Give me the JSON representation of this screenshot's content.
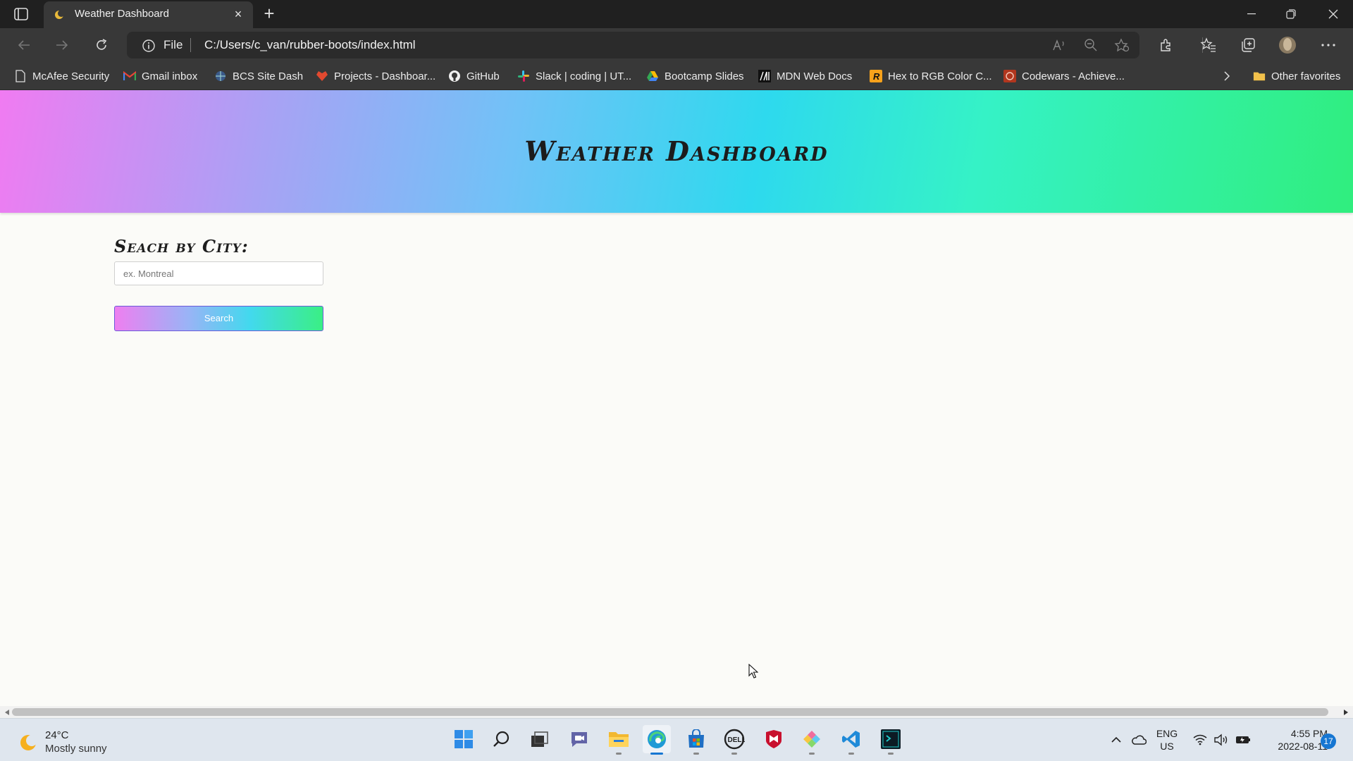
{
  "browser": {
    "tab_title": "Weather Dashboard",
    "new_tab_label": "+",
    "address_scheme": "File",
    "address_url": "C:/Users/c_van/rubber-boots/index.html",
    "bookmarks": [
      {
        "label": "McAfee Security",
        "icon": "page-icon"
      },
      {
        "label": "Gmail inbox",
        "icon": "gmail-icon"
      },
      {
        "label": "BCS Site Dash",
        "icon": "bcs-icon"
      },
      {
        "label": "Projects - Dashboar...",
        "icon": "projects-icon"
      },
      {
        "label": "GitHub",
        "icon": "github-icon"
      },
      {
        "label": "Slack | coding | UT...",
        "icon": "slack-icon"
      },
      {
        "label": "Bootcamp Slides",
        "icon": "drive-icon"
      },
      {
        "label": "MDN Web Docs",
        "icon": "mdn-icon"
      },
      {
        "label": "Hex to RGB Color C...",
        "icon": "hex-rgb-icon"
      },
      {
        "label": "Codewars - Achieve...",
        "icon": "codewars-icon"
      }
    ],
    "other_favorites": "Other favorites"
  },
  "page": {
    "title": "Weather Dashboard",
    "search_label": "Seach by City:",
    "search_placeholder": "ex. Montreal",
    "search_button": "Search"
  },
  "taskbar": {
    "weather_temp": "24°C",
    "weather_condition": "Mostly sunny",
    "language_line1": "ENG",
    "language_line2": "US",
    "time": "4:55 PM",
    "date": "2022-08-11",
    "notification_count": "17"
  },
  "colors": {
    "hero_gradient": [
      "#f07bf2",
      "#70c2f7",
      "#2ed9ee",
      "#30ee7e"
    ],
    "chrome_dark": "#383838",
    "taskbar_accent": "#1676d2"
  }
}
